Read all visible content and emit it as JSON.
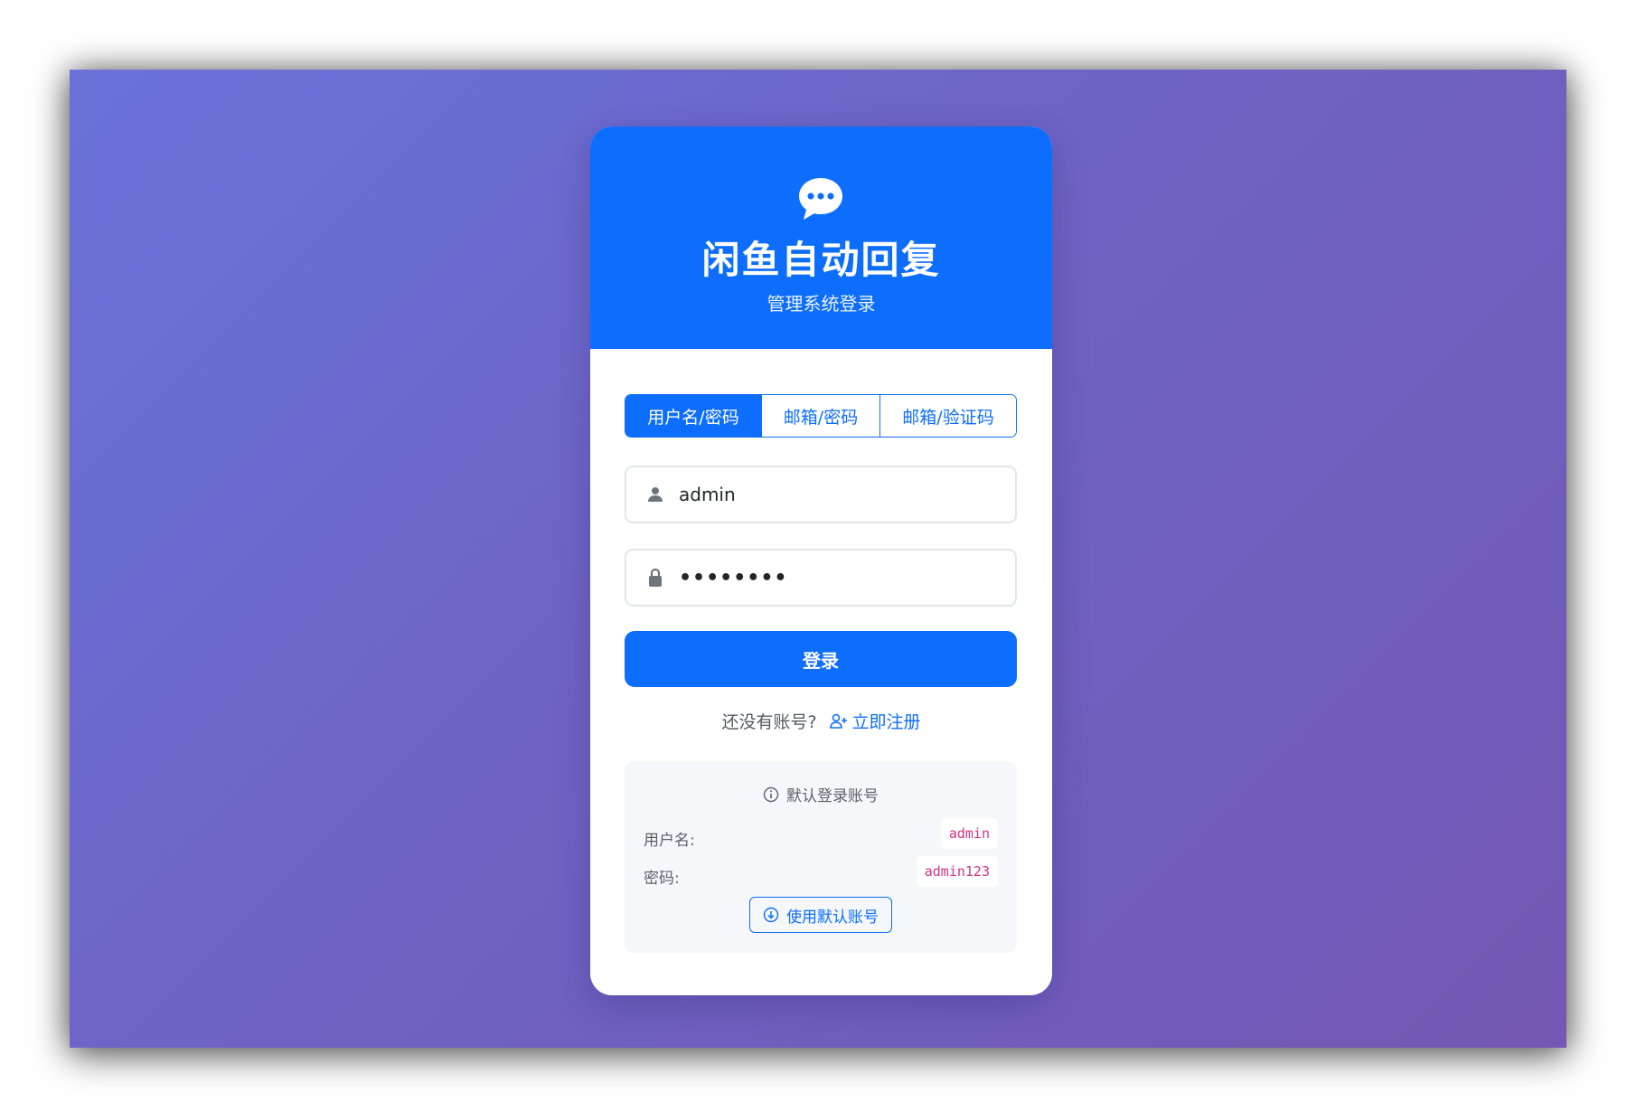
{
  "header": {
    "icon": "chat-dots-icon",
    "title": "闲鱼自动回复",
    "subtitle": "管理系统登录"
  },
  "tabs": [
    {
      "label": "用户名/密码",
      "active": true
    },
    {
      "label": "邮箱/密码",
      "active": false
    },
    {
      "label": "邮箱/验证码",
      "active": false
    }
  ],
  "form": {
    "username": {
      "icon": "user-icon",
      "value": "admin"
    },
    "password": {
      "icon": "lock-icon",
      "value": "••••••••"
    },
    "submit_label": "登录"
  },
  "register": {
    "prompt": "还没有账号?",
    "link_icon": "person-plus-icon",
    "link_label": "立即注册"
  },
  "default_account": {
    "title_icon": "info-circle-icon",
    "title": "默认登录账号",
    "username_label": "用户名:",
    "username_value": "admin",
    "password_label": "密码:",
    "password_value": "admin123",
    "button_icon": "arrow-down-circle-icon",
    "button_label": "使用默认账号"
  },
  "colors": {
    "primary": "#0d6efd",
    "background_start": "#6a72d8",
    "background_end": "#7458b3",
    "code": "#d63384"
  }
}
